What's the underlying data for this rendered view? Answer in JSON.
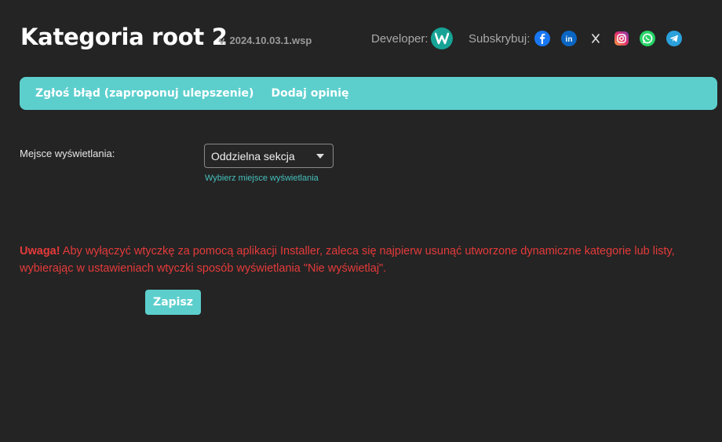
{
  "header": {
    "title": "Kategoria root 2",
    "version": "v. 2024.10.03.1.wsp",
    "developer_label": "Developer:",
    "subscribe_label": "Subskrybuj:",
    "social_icons": [
      "facebook-icon",
      "linkedin-icon",
      "x-icon",
      "instagram-icon",
      "whatsapp-icon",
      "telegram-icon"
    ]
  },
  "nav": {
    "report_bug": "Zgłoś błąd (zaproponuj ulepszenie)",
    "add_review": "Dodaj opinię"
  },
  "form": {
    "display_label": "Mejsce wyświetlania:",
    "display_value": "Oddzielna sekcja",
    "display_hint": "Wybierz miejsce wyświetlania"
  },
  "warning": {
    "prefix": "Uwaga!",
    "text": " Aby wyłączyć wtyczkę za pomocą aplikacji Installer, zaleca się najpierw usunąć utworzone dynamiczne kategorie lub listy, wybierając w ustawieniach wtyczki sposób wyświetlania \"Nie wyświetlaj\"."
  },
  "actions": {
    "save": "Zapisz"
  },
  "colors": {
    "accent": "#5ccfcd",
    "warning": "#e53a3a",
    "background": "#242424"
  }
}
